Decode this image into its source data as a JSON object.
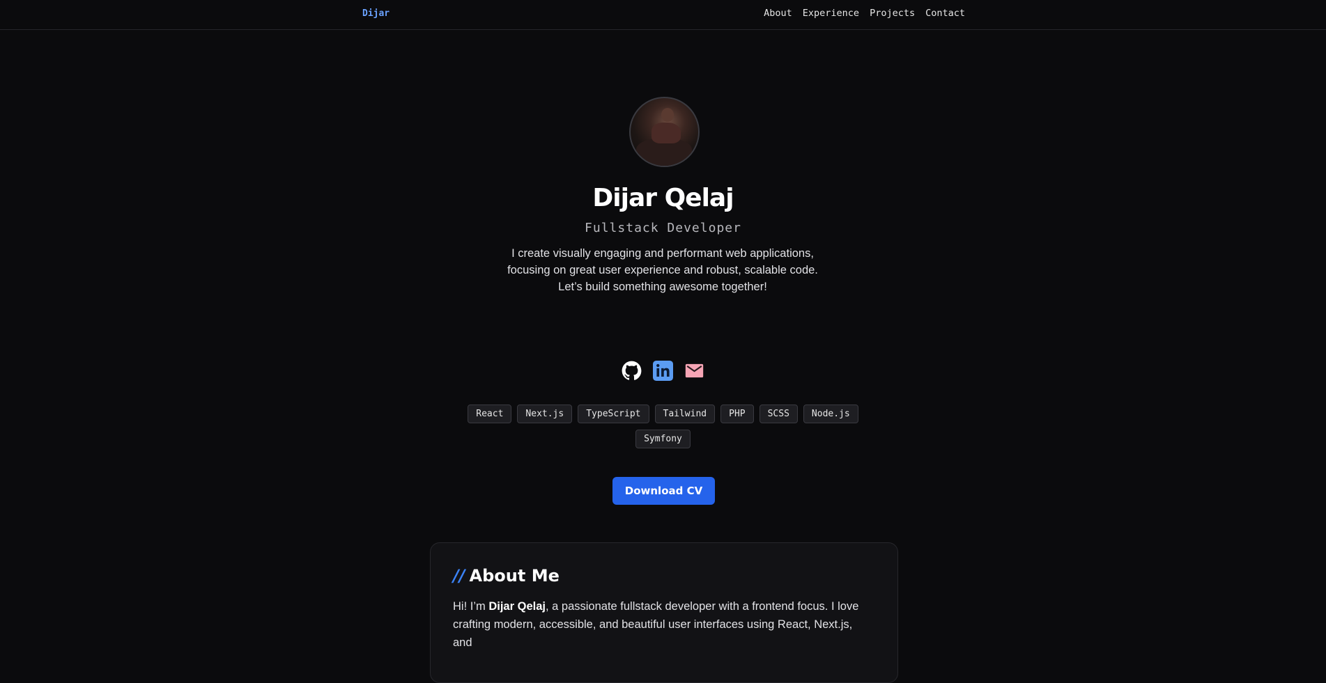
{
  "nav": {
    "brand": "Dijar",
    "links": [
      "About",
      "Experience",
      "Projects",
      "Contact"
    ]
  },
  "hero": {
    "name": "Dijar Qelaj",
    "role": "Fullstack Developer",
    "bio_lines": [
      "I create visually engaging and performant web applications,",
      "focusing on great user experience and robust, scalable code.",
      "Let’s build something awesome together!"
    ],
    "socials": [
      {
        "icon": "github-icon",
        "color": "#ffffff"
      },
      {
        "icon": "linkedin-icon",
        "color": "#5b9cf2"
      },
      {
        "icon": "mail-icon",
        "color": "#f6a5b5"
      }
    ],
    "tags": [
      "React",
      "Next.js",
      "TypeScript",
      "Tailwind",
      "PHP",
      "SCSS",
      "Node.js",
      "Symfony"
    ],
    "cv_button": "Download CV"
  },
  "about": {
    "slashes": "//",
    "title": "About Me",
    "text_prefix": "Hi! I’m ",
    "text_name": "Dijar Qelaj",
    "text_rest": ", a passionate fullstack developer with a frontend focus. I love crafting modern, accessible, and beautiful user interfaces using React, Next.js, and"
  },
  "colors": {
    "background": "#0b0b0d",
    "accent": "#2563eb",
    "brand": "#6aa2ff"
  }
}
